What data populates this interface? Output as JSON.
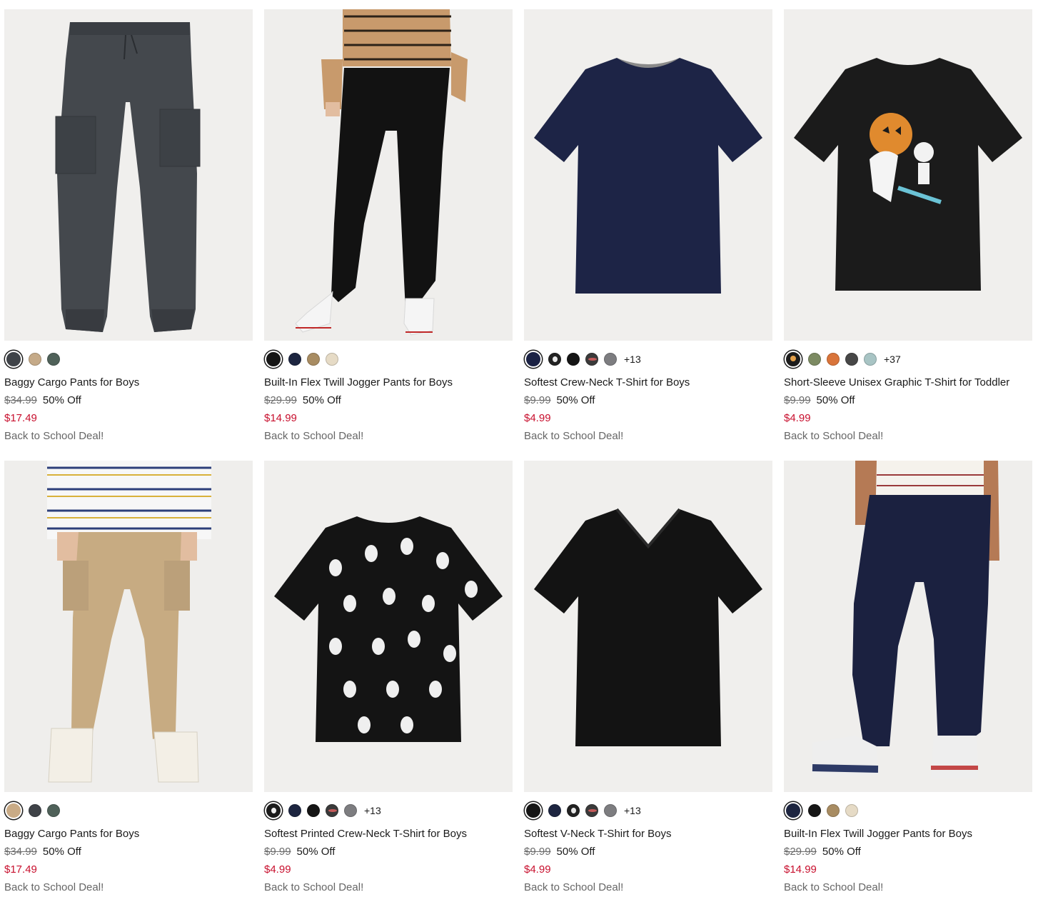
{
  "colors": {
    "sale_price": "#c8102e",
    "image_background": "#f0efed"
  },
  "products": [
    {
      "name": "Baggy Cargo Pants for Boys",
      "original_price": "$34.99",
      "discount": "50% Off",
      "sale_price": "$17.49",
      "promo": "Back to School Deal!",
      "image": "gray-cargo-pants",
      "swatches": [
        "#3f4348",
        "#c5aa88",
        "#4f6159"
      ],
      "more_colors": ""
    },
    {
      "name": "Built-In Flex Twill Jogger Pants for Boys",
      "original_price": "$29.99",
      "discount": "50% Off",
      "sale_price": "$14.99",
      "promo": "Back to School Deal!",
      "image": "black-jogger-pants-model",
      "swatches": [
        "#161616",
        "#1d2540",
        "#a88c62",
        "#e6dbc6"
      ],
      "more_colors": ""
    },
    {
      "name": "Softest Crew-Neck T-Shirt for Boys",
      "original_price": "$9.99",
      "discount": "50% Off",
      "sale_price": "$4.99",
      "promo": "Back to School Deal!",
      "image": "navy-crew-neck-tshirt",
      "swatches": [
        "#1b2244",
        "#222222",
        "#151515",
        "#3a3a3a",
        "#7d7d80"
      ],
      "more_colors": "+13"
    },
    {
      "name": "Short-Sleeve Unisex Graphic T-Shirt for Toddler",
      "original_price": "$9.99",
      "discount": "50% Off",
      "sale_price": "$4.99",
      "promo": "Back to School Deal!",
      "image": "black-graphic-tshirt-too-ghoul-for-school",
      "swatches": [
        "#1c1c1c",
        "#7c8a62",
        "#d9743a",
        "#474747",
        "#a8c4c4"
      ],
      "more_colors": "+37"
    },
    {
      "name": "Baggy Cargo Pants for Boys",
      "original_price": "$34.99",
      "discount": "50% Off",
      "sale_price": "$17.49",
      "promo": "Back to School Deal!",
      "image": "khaki-cargo-pants-model",
      "swatches": [
        "#c9ab86",
        "#3f4348",
        "#4f6159"
      ],
      "more_colors": ""
    },
    {
      "name": "Softest Printed Crew-Neck T-Shirt for Boys",
      "original_price": "$9.99",
      "discount": "50% Off",
      "sale_price": "$4.99",
      "promo": "Back to School Deal!",
      "image": "black-ghost-print-tshirt",
      "swatches": [
        "#1b1b1b",
        "#1d2540",
        "#151515",
        "#3a3a3a",
        "#7d7d80"
      ],
      "more_colors": "+13"
    },
    {
      "name": "Softest V-Neck T-Shirt for Boys",
      "original_price": "$9.99",
      "discount": "50% Off",
      "sale_price": "$4.99",
      "promo": "Back to School Deal!",
      "image": "black-v-neck-tshirt",
      "swatches": [
        "#151515",
        "#1d2540",
        "#222222",
        "#3a3a3a",
        "#7d7d80"
      ],
      "more_colors": "+13"
    },
    {
      "name": "Built-In Flex Twill Jogger Pants for Boys",
      "original_price": "$29.99",
      "discount": "50% Off",
      "sale_price": "$14.99",
      "promo": "Back to School Deal!",
      "image": "navy-jogger-pants-model",
      "swatches": [
        "#1d2540",
        "#161616",
        "#a88c62",
        "#e6dbc6"
      ],
      "more_colors": ""
    }
  ]
}
